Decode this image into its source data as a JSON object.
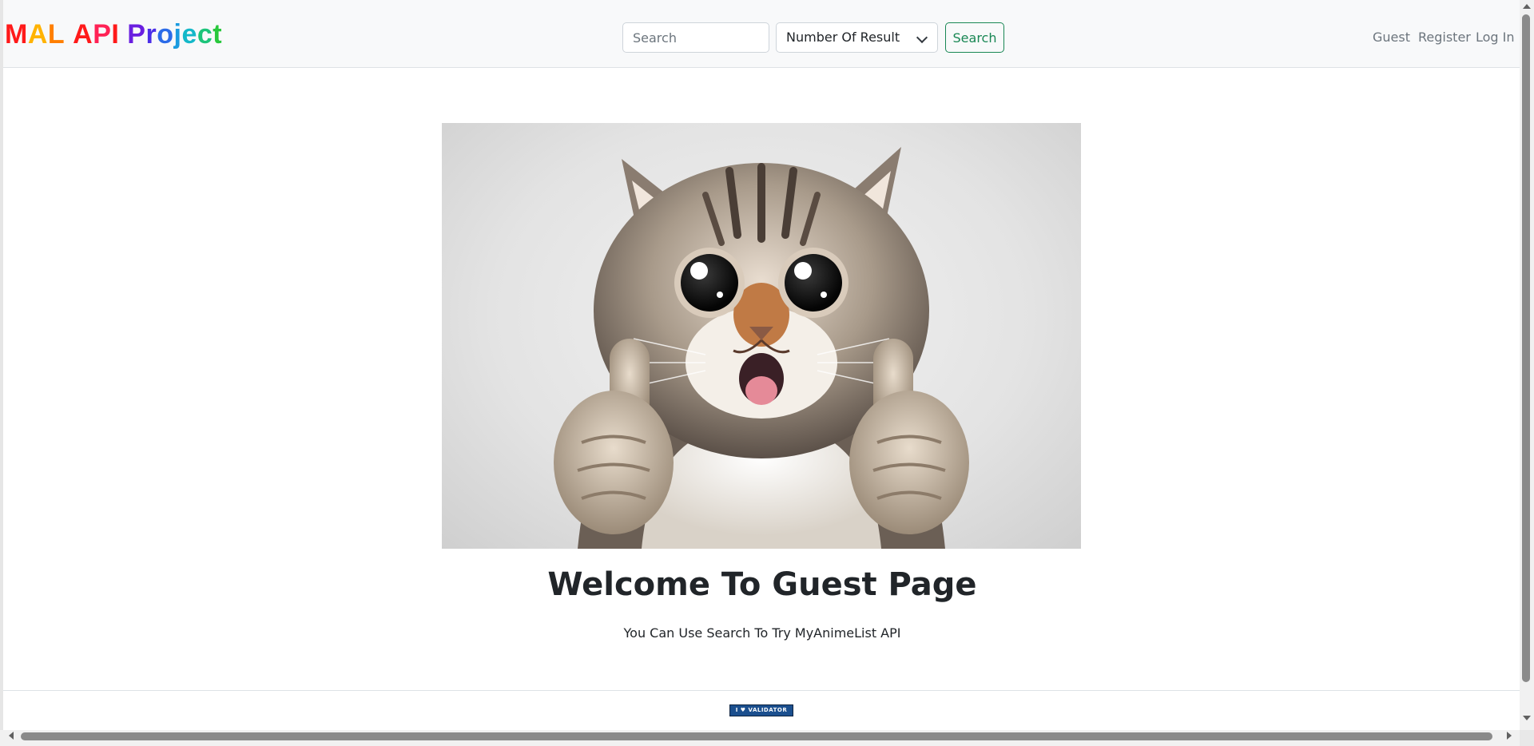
{
  "navbar": {
    "brand_letters": [
      {
        "ch": "M",
        "color": "#ff1a1a"
      },
      {
        "ch": "A",
        "color": "#ffb300"
      },
      {
        "ch": "L",
        "color": "#ff7f00"
      },
      {
        "ch": " ",
        "color": "#000000"
      },
      {
        "ch": "A",
        "color": "#ff1a1a"
      },
      {
        "ch": "P",
        "color": "#ff2255"
      },
      {
        "ch": "I",
        "color": "#ff1a1a"
      },
      {
        "ch": " ",
        "color": "#000000"
      },
      {
        "ch": "P",
        "color": "#6a1fe0"
      },
      {
        "ch": "r",
        "color": "#4b2ee8"
      },
      {
        "ch": "o",
        "color": "#2b6be8"
      },
      {
        "ch": "j",
        "color": "#1a9be0"
      },
      {
        "ch": "e",
        "color": "#14b8c9"
      },
      {
        "ch": "c",
        "color": "#1cc47a"
      },
      {
        "ch": "t",
        "color": "#28c83c"
      }
    ],
    "search_placeholder": "Search",
    "search_value": "",
    "select_label": "Number Of Result",
    "search_button": "Search",
    "links": [
      "Guest",
      "Register",
      "Log In"
    ]
  },
  "main": {
    "hero_image_label": "smiling cat giving two thumbs up",
    "title": "Welcome To Guest Page",
    "subtitle": "You Can Use Search To Try MyAnimeList API"
  },
  "footer": {
    "badge": "I ♥ VALIDATOR"
  },
  "colors": {
    "success": "#198754",
    "nav_link": "#6c757d",
    "navbar_bg": "#f8f9fa"
  }
}
